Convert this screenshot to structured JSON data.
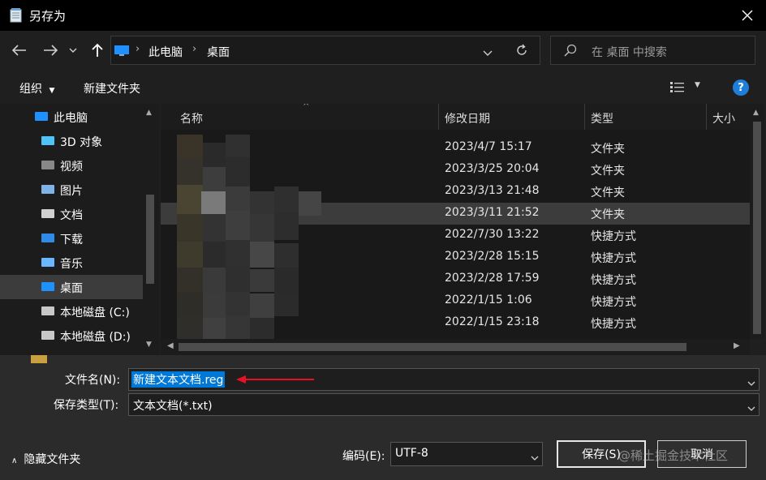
{
  "window": {
    "title": "另存为"
  },
  "nav": {
    "address": [
      "此电脑",
      "桌面"
    ],
    "search_placeholder": "在 桌面 中搜索"
  },
  "toolbar": {
    "organize": "组织",
    "new_folder": "新建文件夹"
  },
  "sidebar": {
    "items": [
      {
        "label": "此电脑",
        "icon": "computer-icon"
      },
      {
        "label": "3D 对象",
        "icon": "cube-icon"
      },
      {
        "label": "视频",
        "icon": "video-icon"
      },
      {
        "label": "图片",
        "icon": "picture-icon"
      },
      {
        "label": "文档",
        "icon": "document-icon"
      },
      {
        "label": "下载",
        "icon": "download-icon"
      },
      {
        "label": "音乐",
        "icon": "music-icon"
      },
      {
        "label": "桌面",
        "icon": "desktop-icon",
        "selected": true
      },
      {
        "label": "本地磁盘 (C:)",
        "icon": "drive-icon"
      },
      {
        "label": "本地磁盘 (D:)",
        "icon": "drive-icon"
      }
    ]
  },
  "files": {
    "columns": [
      "名称",
      "修改日期",
      "类型",
      "大小"
    ],
    "rows": [
      {
        "date": "2023/4/7 15:17",
        "type": "文件夹"
      },
      {
        "date": "2023/3/25 20:04",
        "type": "文件夹"
      },
      {
        "date": "2023/3/13 21:48",
        "type": "文件夹"
      },
      {
        "date": "2023/3/11 21:52",
        "type": "文件夹",
        "selected": true
      },
      {
        "date": "2022/7/30 13:22",
        "type": "快捷方式"
      },
      {
        "date": "2023/2/28 15:15",
        "type": "快捷方式"
      },
      {
        "date": "2023/2/28 17:59",
        "type": "快捷方式"
      },
      {
        "date": "2022/1/15 1:06",
        "type": "快捷方式"
      },
      {
        "date": "2022/1/15 23:18",
        "type": "快捷方式"
      }
    ]
  },
  "form": {
    "filename_label": "文件名(N):",
    "filename_value": "新建文本文档.reg",
    "filetype_label": "保存类型(T):",
    "filetype_value": "文本文档(*.txt)",
    "hide_folders": "隐藏文件夹",
    "encoding_label": "编码(E):",
    "encoding_value": "UTF-8",
    "save": "保存(S)",
    "cancel": "取消",
    "watermark": "@稀土掘金技术社区"
  },
  "colors": {
    "accent": "#0078d7",
    "arrow": "#e81123",
    "selection": "#3c3c3c"
  }
}
